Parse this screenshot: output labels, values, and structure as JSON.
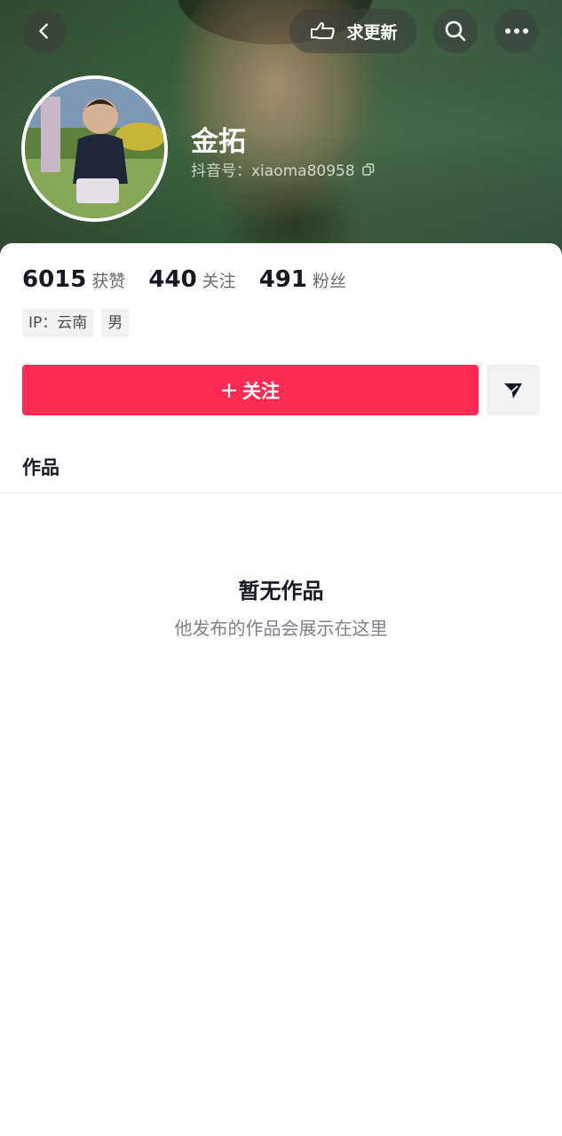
{
  "header": {
    "update_label": "求更新"
  },
  "profile": {
    "name": "金拓",
    "douyin_id_label": "抖音号：",
    "douyin_id": "xiaoma80958"
  },
  "stats": [
    {
      "value": "6015",
      "label": "获赞"
    },
    {
      "value": "440",
      "label": "关注"
    },
    {
      "value": "491",
      "label": "粉丝"
    }
  ],
  "tags": [
    "IP：云南",
    "男"
  ],
  "actions": {
    "follow_label": "关注"
  },
  "tabs": {
    "works_label": "作品"
  },
  "empty_state": {
    "title": "暂无作品",
    "subtitle": "他发布的作品会展示在这里"
  },
  "colors": {
    "accent": "#fe2c55"
  }
}
